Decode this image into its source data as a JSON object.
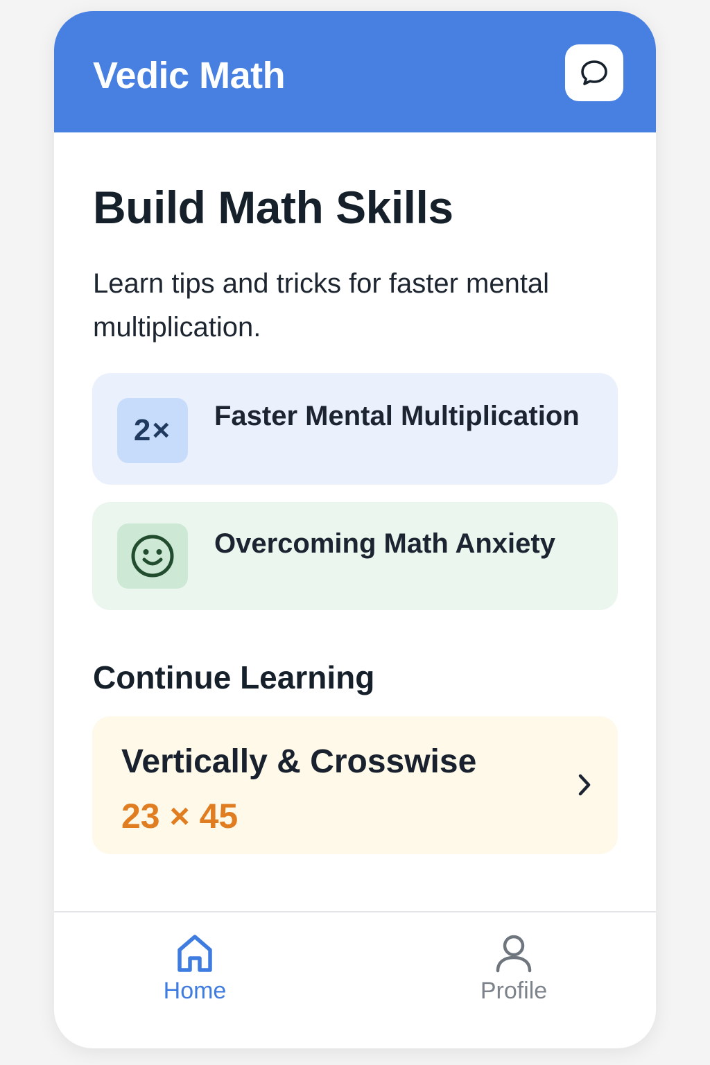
{
  "header": {
    "title": "Vedic Math",
    "chat_icon": "chat-bubble-icon"
  },
  "intro": {
    "title": "Build Math Skills",
    "subtitle": "Learn tips and tricks for faster mental multiplication."
  },
  "topics": [
    {
      "label": "Faster Mental Multiplication",
      "icon_text": "2×",
      "icon": "multiply-icon",
      "bg": "#eaf1fd",
      "icon_bg": "#c7dcfb"
    },
    {
      "label": "Overcoming Math Anxiety",
      "icon": "smiley-face-icon",
      "bg": "#eaf6ee",
      "icon_bg": "#cde8d5"
    }
  ],
  "continue": {
    "section_title": "Continue Learning",
    "lesson_title": "Vertically & Crosswise",
    "lesson_example": "23 × 45",
    "icon": "chevron-right-icon"
  },
  "nav": {
    "items": [
      {
        "label": "Home",
        "icon": "home-icon",
        "active": true
      },
      {
        "label": "Profile",
        "icon": "user-icon",
        "active": false
      }
    ]
  },
  "colors": {
    "header_bg": "#4880e2",
    "accent": "#3f7ce0",
    "example_orange": "#e07d20",
    "inactive_nav": "#7d838b"
  }
}
